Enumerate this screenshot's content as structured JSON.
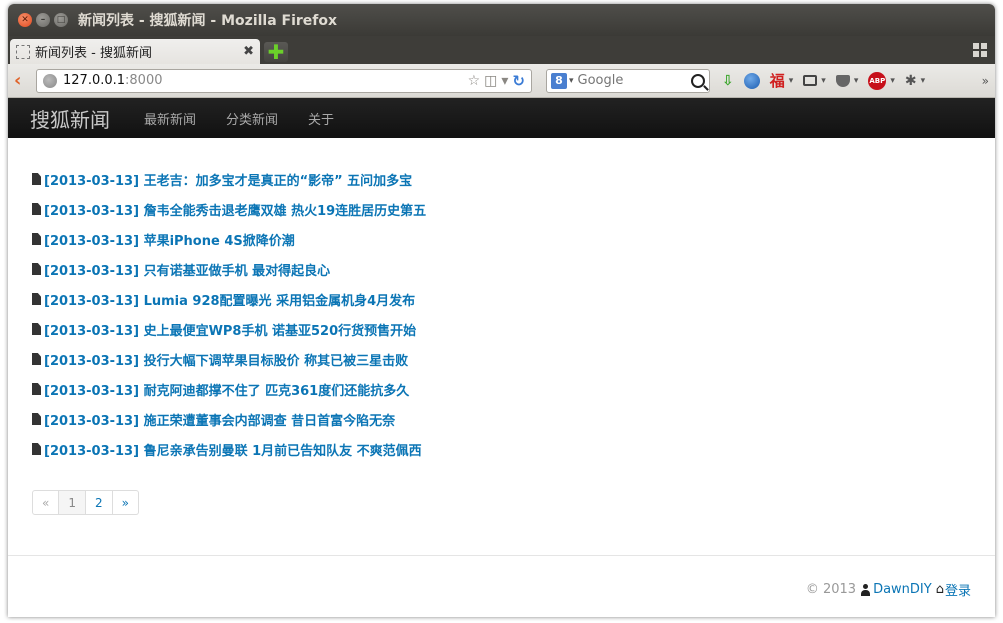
{
  "window": {
    "title": "新闻列表 - 搜狐新闻 - Mozilla Firefox"
  },
  "tab": {
    "label": "新闻列表 - 搜狐新闻",
    "close": "✖",
    "new": "✚"
  },
  "urlbar": {
    "host": "127.0.0.1",
    "port": ":8000"
  },
  "search": {
    "engine_badge": "8",
    "placeholder": "Google"
  },
  "toolbar": {
    "fu": "福",
    "abp": "ABP"
  },
  "site": {
    "brand": "搜狐新闻",
    "nav": [
      "最新新闻",
      "分类新闻",
      "关于"
    ]
  },
  "news": [
    "[2013-03-13] 王老吉：加多宝才是真正的“影帝” 五问加多宝",
    "[2013-03-13] 詹韦全能秀击退老鹰双雄 热火19连胜居历史第五",
    "[2013-03-13] 苹果iPhone 4S掀降价潮",
    "[2013-03-13] 只有诺基亚做手机 最对得起良心",
    "[2013-03-13] Lumia 928配置曝光 采用铝金属机身4月发布",
    "[2013-03-13] 史上最便宜WP8手机 诺基亚520行货预售开始",
    "[2013-03-13] 投行大幅下调苹果目标股价 称其已被三星击败",
    "[2013-03-13] 耐克阿迪都撑不住了 匹克361度们还能抗多久",
    "[2013-03-13] 施正荣遭董事会内部调查 昔日首富今陷无奈",
    "[2013-03-13] 鲁尼亲承告别曼联 1月前已告知队友 不爽范佩西"
  ],
  "pagination": {
    "prev": "«",
    "pages": [
      "1",
      "2"
    ],
    "next": "»",
    "current": "1"
  },
  "footer": {
    "copyright": "© 2013",
    "user": "DawnDIY",
    "login": "登录"
  }
}
